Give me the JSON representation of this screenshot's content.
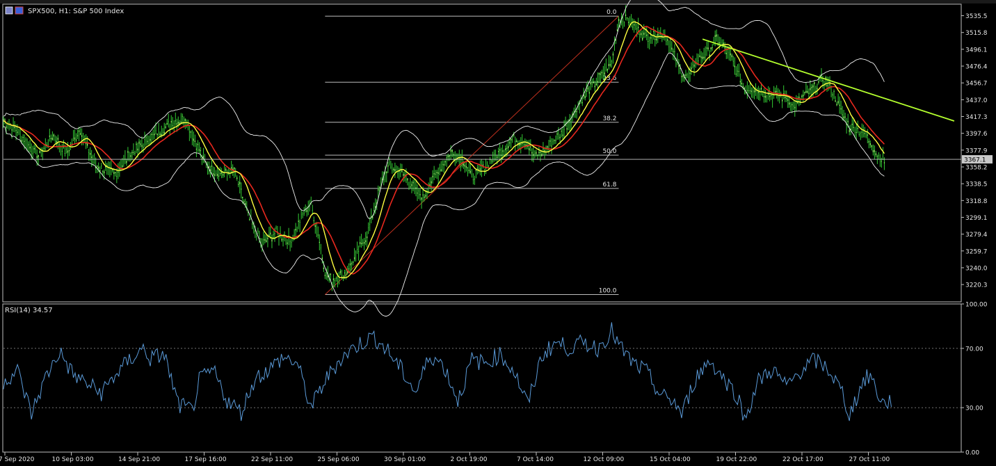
{
  "chart_data": [
    {
      "type": "line",
      "title": "SPX500, H1:  S&P 500 Index",
      "ylim": [
        3200.0,
        3549.0
      ],
      "y_ticks": [
        "3535.5",
        "3515.8",
        "3496.1",
        "3476.4",
        "3456.7",
        "3437.0",
        "3417.3",
        "3397.6",
        "3377.9",
        "3358.2",
        "3338.5",
        "3318.8",
        "3299.1",
        "3279.4",
        "3259.7",
        "3240.0",
        "3220.3"
      ],
      "current_price_label": "3367.1",
      "current_price": 3367.1,
      "x_ticks": [
        "7 Sep 2020",
        "10 Sep 03:00",
        "14 Sep 21:00",
        "17 Sep 16:00",
        "22 Sep 11:00",
        "25 Sep 06:00",
        "30 Sep 01:00",
        "2 Oct 19:00",
        "7 Oct 14:00",
        "12 Oct 09:00",
        "15 Oct 04:00",
        "19 Oct 22:00",
        "22 Oct 17:00",
        "27 Oct 11:00"
      ],
      "price_keypoints": [
        [
          0,
          3412
        ],
        [
          2,
          3400
        ],
        [
          5,
          3370
        ],
        [
          7,
          3395
        ],
        [
          9,
          3375
        ],
        [
          11,
          3402
        ],
        [
          13,
          3360
        ],
        [
          16,
          3350
        ],
        [
          18,
          3372
        ],
        [
          21,
          3392
        ],
        [
          24,
          3410
        ],
        [
          26,
          3415
        ],
        [
          27,
          3395
        ],
        [
          29,
          3360
        ],
        [
          31,
          3350
        ],
        [
          33,
          3355
        ],
        [
          35,
          3300
        ],
        [
          37,
          3268
        ],
        [
          39,
          3282
        ],
        [
          41,
          3270
        ],
        [
          43,
          3305
        ],
        [
          44,
          3313
        ],
        [
          45,
          3280
        ],
        [
          46,
          3236
        ],
        [
          47,
          3225
        ],
        [
          49,
          3235
        ],
        [
          50,
          3248
        ],
        [
          52,
          3278
        ],
        [
          54,
          3338
        ],
        [
          55,
          3358
        ],
        [
          57,
          3352
        ],
        [
          59,
          3330
        ],
        [
          60,
          3322
        ],
        [
          62,
          3352
        ],
        [
          64,
          3375
        ],
        [
          66,
          3365
        ],
        [
          67,
          3345
        ],
        [
          69,
          3360
        ],
        [
          71,
          3375
        ],
        [
          73,
          3392
        ],
        [
          75,
          3385
        ],
        [
          76,
          3370
        ],
        [
          78,
          3382
        ],
        [
          80,
          3400
        ],
        [
          83,
          3440
        ],
        [
          85,
          3460
        ],
        [
          87,
          3480
        ],
        [
          88,
          3530
        ],
        [
          89,
          3532
        ],
        [
          90,
          3525
        ],
        [
          92,
          3510
        ],
        [
          94,
          3515
        ],
        [
          95,
          3508
        ],
        [
          96,
          3488
        ],
        [
          97,
          3468
        ],
        [
          98,
          3462
        ],
        [
          99,
          3482
        ],
        [
          101,
          3495
        ],
        [
          102,
          3508
        ],
        [
          104,
          3488
        ],
        [
          105,
          3468
        ],
        [
          106,
          3450
        ],
        [
          108,
          3448
        ],
        [
          110,
          3442
        ],
        [
          112,
          3440
        ],
        [
          113,
          3428
        ],
        [
          115,
          3445
        ],
        [
          116,
          3450
        ],
        [
          117,
          3462
        ],
        [
          118,
          3455
        ],
        [
          119,
          3440
        ],
        [
          120,
          3420
        ],
        [
          121,
          3405
        ],
        [
          122,
          3402
        ],
        [
          123,
          3398
        ],
        [
          124,
          3388
        ],
        [
          125,
          3372
        ],
        [
          126,
          3365
        ]
      ],
      "fibonacci": [
        {
          "label": "0.0",
          "price": 3535.0
        },
        {
          "label": "23.6",
          "price": 3457.5
        },
        {
          "label": "38.2",
          "price": 3410.5
        },
        {
          "label": "50.0",
          "price": 3372.0
        },
        {
          "label": "61.8",
          "price": 3333.0
        },
        {
          "label": "100.0",
          "price": 3208.5
        }
      ],
      "fib_trend_line": {
        "x": [
          46,
          88
        ],
        "y": [
          3208.5,
          3535.0
        ]
      },
      "trendline": {
        "x": [
          100,
          136
        ],
        "y": [
          3508,
          3412
        ]
      },
      "x_domain": [
        0,
        137
      ],
      "colors": {
        "candles": "#33cc33",
        "bands": "#f0f0f0",
        "ma_red": "#e8281e",
        "ma_yellow": "#ffff40",
        "fib": "#d8d8d8",
        "fib_trend": "#c0301e",
        "trendline": "#b4ff2e",
        "axis": "#bfbfbf",
        "text": "#e6e6e6"
      }
    },
    {
      "type": "line",
      "title": "RSI(14) 34.57",
      "ylim": [
        0,
        100
      ],
      "y_ticks": [
        "100.00",
        "70.00",
        "30.00",
        "0.00"
      ],
      "levels": [
        70,
        30
      ],
      "rsi_keypoints": [
        [
          0,
          48
        ],
        [
          2,
          55
        ],
        [
          4,
          26
        ],
        [
          6,
          50
        ],
        [
          8,
          68
        ],
        [
          10,
          52
        ],
        [
          12,
          46
        ],
        [
          14,
          40
        ],
        [
          16,
          52
        ],
        [
          18,
          62
        ],
        [
          20,
          70
        ],
        [
          21,
          63
        ],
        [
          23,
          66
        ],
        [
          25,
          32
        ],
        [
          27,
          28
        ],
        [
          28,
          48
        ],
        [
          30,
          55
        ],
        [
          32,
          35
        ],
        [
          34,
          27
        ],
        [
          36,
          50
        ],
        [
          38,
          56
        ],
        [
          40,
          64
        ],
        [
          42,
          60
        ],
        [
          44,
          30
        ],
        [
          46,
          48
        ],
        [
          48,
          62
        ],
        [
          50,
          70
        ],
        [
          52,
          76
        ],
        [
          53,
          78
        ],
        [
          55,
          68
        ],
        [
          57,
          55
        ],
        [
          59,
          40
        ],
        [
          61,
          66
        ],
        [
          63,
          58
        ],
        [
          65,
          35
        ],
        [
          67,
          62
        ],
        [
          69,
          60
        ],
        [
          71,
          66
        ],
        [
          73,
          55
        ],
        [
          75,
          32
        ],
        [
          77,
          65
        ],
        [
          79,
          74
        ],
        [
          81,
          70
        ],
        [
          83,
          74
        ],
        [
          85,
          70
        ],
        [
          87,
          82
        ],
        [
          88,
          72
        ],
        [
          90,
          60
        ],
        [
          92,
          54
        ],
        [
          94,
          38
        ],
        [
          96,
          34
        ],
        [
          97,
          25
        ],
        [
          99,
          50
        ],
        [
          101,
          62
        ],
        [
          103,
          50
        ],
        [
          105,
          38
        ],
        [
          106,
          22
        ],
        [
          108,
          48
        ],
        [
          110,
          56
        ],
        [
          112,
          44
        ],
        [
          114,
          55
        ],
        [
          116,
          62
        ],
        [
          118,
          56
        ],
        [
          120,
          40
        ],
        [
          121,
          25
        ],
        [
          123,
          48
        ],
        [
          124,
          52
        ],
        [
          125,
          40
        ],
        [
          126,
          32
        ],
        [
          127,
          35
        ]
      ],
      "colors": {
        "line": "#5a9ad8",
        "level": "#9a9a9a"
      }
    }
  ]
}
